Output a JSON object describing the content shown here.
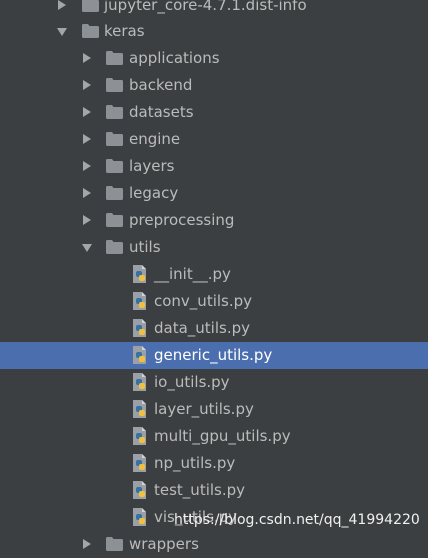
{
  "tree": {
    "rows": [
      {
        "label": "jupyter_core-4.7.1.dist-info",
        "type": "folder",
        "expanded": false
      },
      {
        "label": "keras",
        "type": "folder",
        "expanded": true
      },
      {
        "label": "applications",
        "type": "folder",
        "expanded": false
      },
      {
        "label": "backend",
        "type": "folder",
        "expanded": false
      },
      {
        "label": "datasets",
        "type": "folder",
        "expanded": false
      },
      {
        "label": "engine",
        "type": "folder",
        "expanded": false
      },
      {
        "label": "layers",
        "type": "folder",
        "expanded": false
      },
      {
        "label": "legacy",
        "type": "folder",
        "expanded": false
      },
      {
        "label": "preprocessing",
        "type": "folder",
        "expanded": false
      },
      {
        "label": "utils",
        "type": "folder",
        "expanded": true
      },
      {
        "label": "__init__.py",
        "type": "python-file"
      },
      {
        "label": "conv_utils.py",
        "type": "python-file"
      },
      {
        "label": "data_utils.py",
        "type": "python-file"
      },
      {
        "label": "generic_utils.py",
        "type": "python-file",
        "selected": true
      },
      {
        "label": "io_utils.py",
        "type": "python-file"
      },
      {
        "label": "layer_utils.py",
        "type": "python-file"
      },
      {
        "label": "multi_gpu_utils.py",
        "type": "python-file"
      },
      {
        "label": "np_utils.py",
        "type": "python-file"
      },
      {
        "label": "test_utils.py",
        "type": "python-file"
      },
      {
        "label": "vis_utils.py",
        "type": "python-file"
      },
      {
        "label": "wrappers",
        "type": "folder",
        "expanded": false
      }
    ]
  },
  "watermark": "https://blog.csdn.net/qq_41994220",
  "colors": {
    "background": "#3c3f41",
    "selection": "#4b6eaf",
    "folder": "#8c9196",
    "text": "#bbbbbb",
    "python_blue": "#3572a5",
    "python_yellow": "#f0c040"
  }
}
